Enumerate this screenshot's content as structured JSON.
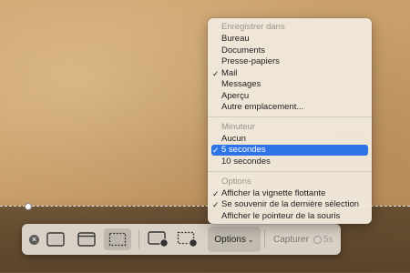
{
  "menu": {
    "save_header": "Enregistrer dans",
    "save_items": [
      {
        "label": "Bureau",
        "checked": false
      },
      {
        "label": "Documents",
        "checked": false
      },
      {
        "label": "Presse-papiers",
        "checked": false
      },
      {
        "label": "Mail",
        "checked": true
      },
      {
        "label": "Messages",
        "checked": false
      },
      {
        "label": "Aperçu",
        "checked": false
      },
      {
        "label": "Autre emplacement...",
        "checked": false
      }
    ],
    "timer_header": "Minuteur",
    "timer_items": [
      {
        "label": "Aucun",
        "checked": false
      },
      {
        "label": "5 secondes",
        "checked": true
      },
      {
        "label": "10 secondes",
        "checked": false
      }
    ],
    "options_header": "Options",
    "option_items": [
      {
        "label": "Afficher la vignette flottante",
        "checked": true
      },
      {
        "label": "Se souvenir de la dernière sélection",
        "checked": true
      },
      {
        "label": "Afficher le pointeur de la souris",
        "checked": false
      }
    ],
    "check_glyph": "✓"
  },
  "toolbar": {
    "close_glyph": "×",
    "options_label": "Options",
    "options_chevron": "⌄",
    "capture_label": "Capturer",
    "capture_timer": "5s",
    "icons": [
      "capture-entire-screen-icon",
      "capture-window-icon",
      "capture-selection-icon",
      "record-entire-screen-icon",
      "record-selection-icon"
    ]
  },
  "colors": {
    "accent": "#2f74e7",
    "menu_bg": "#f1e8db",
    "toolbar_bg": "#ded6cc"
  }
}
